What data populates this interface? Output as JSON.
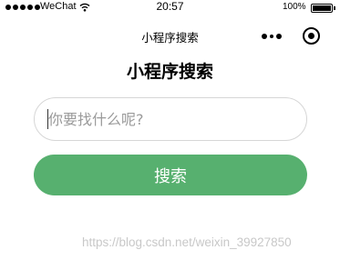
{
  "status_bar": {
    "carrier": "WeChat",
    "time": "20:57",
    "battery_percent": "100%",
    "battery_level": 1.0,
    "icons": [
      "signal-dots-icon",
      "wifi-icon",
      "battery-icon"
    ]
  },
  "nav_bar": {
    "title": "小程序搜索",
    "icons": [
      "more-dots-icon",
      "close-circle-icon"
    ]
  },
  "page": {
    "title": "小程序搜索"
  },
  "search": {
    "placeholder": "你要找什么呢?",
    "value": "",
    "button_label": "搜索"
  },
  "watermark": {
    "text": "https://blog.csdn.net/weixin_39927850"
  },
  "colors": {
    "button_bg": "#57b06f",
    "button_text": "#ffffff",
    "input_border": "#d6d6d6",
    "placeholder": "#9a9a9a",
    "watermark": "#c8c8c8"
  }
}
